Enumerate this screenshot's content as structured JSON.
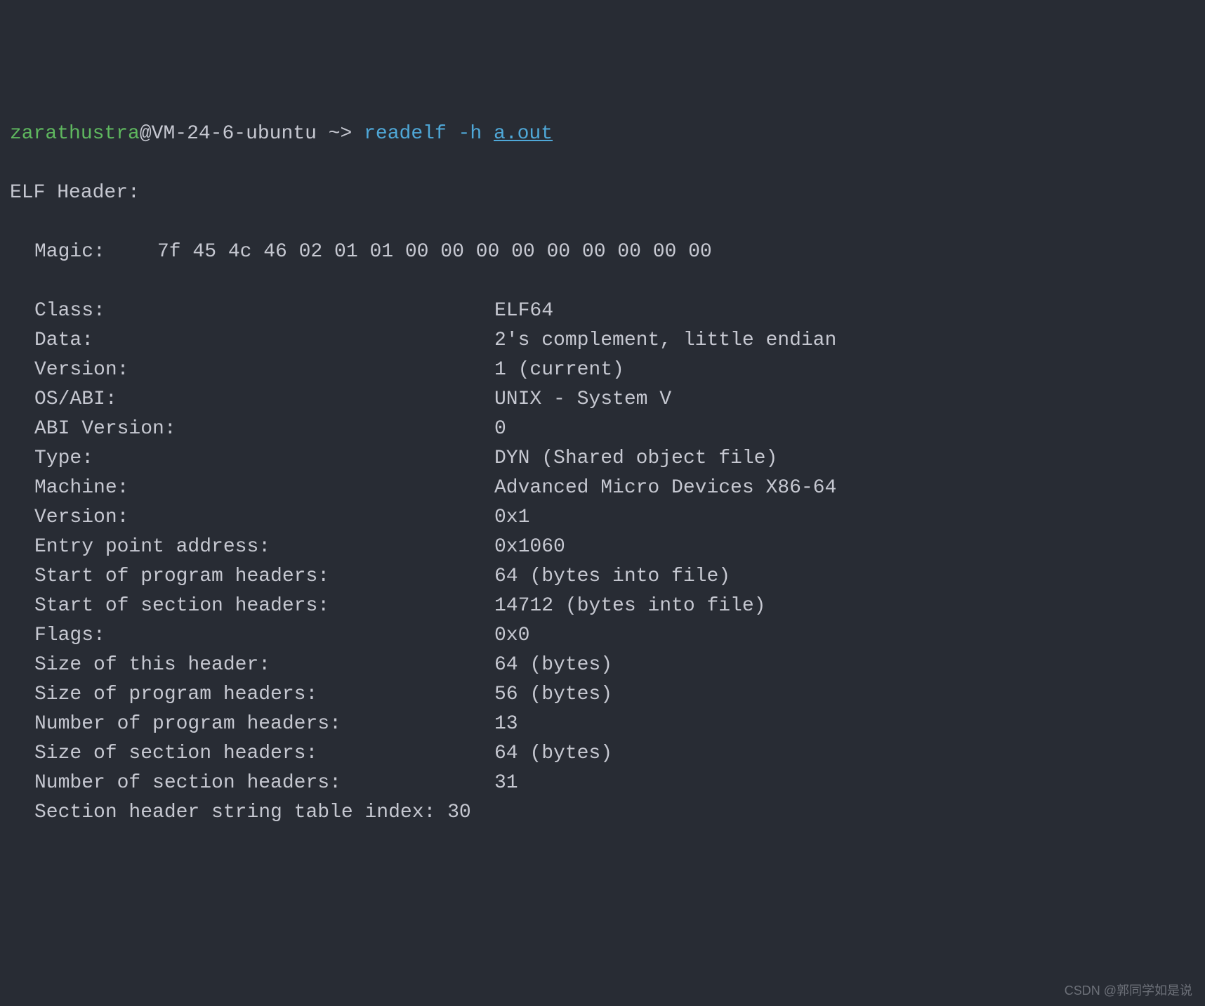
{
  "prompt": {
    "user": "zarathustra",
    "at": "@",
    "host": "VM-24-6-ubuntu",
    "path_sep": " ~> ",
    "command": "readelf -h ",
    "filename": "a.out"
  },
  "output": {
    "header_title": "ELF Header:",
    "magic": {
      "label": "Magic:",
      "value": "7f 45 4c 46 02 01 01 00 00 00 00 00 00 00 00 00 "
    },
    "fields": [
      {
        "label": "Class:",
        "value": "ELF64"
      },
      {
        "label": "Data:",
        "value": "2's complement, little endian"
      },
      {
        "label": "Version:",
        "value": "1 (current)"
      },
      {
        "label": "OS/ABI:",
        "value": "UNIX - System V"
      },
      {
        "label": "ABI Version:",
        "value": "0"
      },
      {
        "label": "Type:",
        "value": "DYN (Shared object file)"
      },
      {
        "label": "Machine:",
        "value": "Advanced Micro Devices X86-64"
      },
      {
        "label": "Version:",
        "value": "0x1"
      },
      {
        "label": "Entry point address:",
        "value": "0x1060"
      },
      {
        "label": "Start of program headers:",
        "value": "64 (bytes into file)"
      },
      {
        "label": "Start of section headers:",
        "value": "14712 (bytes into file)"
      },
      {
        "label": "Flags:",
        "value": "0x0"
      },
      {
        "label": "Size of this header:",
        "value": "64 (bytes)"
      },
      {
        "label": "Size of program headers:",
        "value": "56 (bytes)"
      },
      {
        "label": "Number of program headers:",
        "value": "13"
      },
      {
        "label": "Size of section headers:",
        "value": "64 (bytes)"
      },
      {
        "label": "Number of section headers:",
        "value": "31"
      },
      {
        "label": "Section header string table index:",
        "value": "30"
      }
    ]
  },
  "watermark": "CSDN @郭同学如是说"
}
